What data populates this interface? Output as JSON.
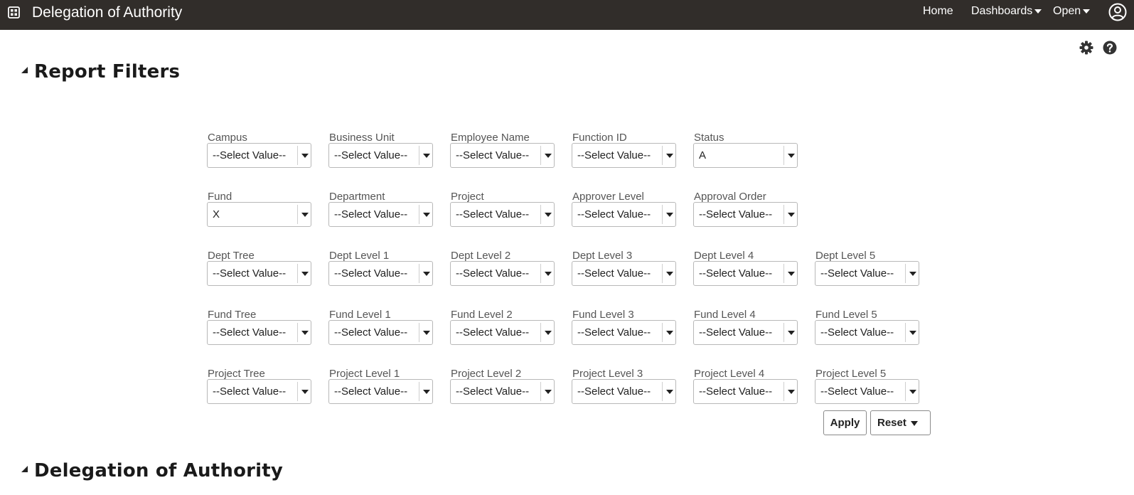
{
  "header": {
    "app_title": "Delegation of Authority",
    "nav": [
      {
        "label": "Home"
      },
      {
        "label": "Dashboards"
      },
      {
        "label": "Open"
      }
    ]
  },
  "sections": {
    "filters_title": "Report Filters",
    "report_title": "Delegation of Authority"
  },
  "filters": [
    [
      {
        "label": "Campus",
        "value": "--Select Value--"
      },
      {
        "label": "Business Unit",
        "value": "--Select Value--"
      },
      {
        "label": "Employee Name",
        "value": "--Select Value--"
      },
      {
        "label": "Function ID",
        "value": "--Select Value--"
      },
      {
        "label": "Status",
        "value": "A"
      }
    ],
    [
      {
        "label": "Fund",
        "value": "X"
      },
      {
        "label": "Department",
        "value": "--Select Value--"
      },
      {
        "label": "Project",
        "value": "--Select Value--"
      },
      {
        "label": "Approver Level",
        "value": "--Select Value--"
      },
      {
        "label": "Approval Order",
        "value": "--Select Value--"
      }
    ],
    [
      {
        "label": "Dept Tree",
        "value": "--Select Value--"
      },
      {
        "label": "Dept Level 1",
        "value": "--Select Value--"
      },
      {
        "label": "Dept Level 2",
        "value": "--Select Value--"
      },
      {
        "label": "Dept Level 3",
        "value": "--Select Value--"
      },
      {
        "label": "Dept Level 4",
        "value": "--Select Value--"
      },
      {
        "label": "Dept Level 5",
        "value": "--Select Value--"
      }
    ],
    [
      {
        "label": "Fund Tree",
        "value": "--Select Value--"
      },
      {
        "label": "Fund Level 1",
        "value": "--Select Value--"
      },
      {
        "label": "Fund Level 2",
        "value": "--Select Value--"
      },
      {
        "label": "Fund Level 3",
        "value": "--Select Value--"
      },
      {
        "label": "Fund Level 4",
        "value": "--Select Value--"
      },
      {
        "label": "Fund Level 5",
        "value": "--Select Value--"
      }
    ],
    [
      {
        "label": "Project Tree",
        "value": "--Select Value--"
      },
      {
        "label": "Project Level 1",
        "value": "--Select Value--"
      },
      {
        "label": "Project Level 2",
        "value": "--Select Value--"
      },
      {
        "label": "Project Level 3",
        "value": "--Select Value--"
      },
      {
        "label": "Project Level 4",
        "value": "--Select Value--"
      },
      {
        "label": "Project Level 5",
        "value": "--Select Value--"
      }
    ]
  ],
  "buttons": {
    "apply": "Apply",
    "reset": "Reset"
  },
  "icons": {
    "app_menu": "grid-icon",
    "user": "user-icon",
    "settings": "gear-icon",
    "help": "help-icon"
  },
  "colors": {
    "header_bg": "#312d2a"
  }
}
